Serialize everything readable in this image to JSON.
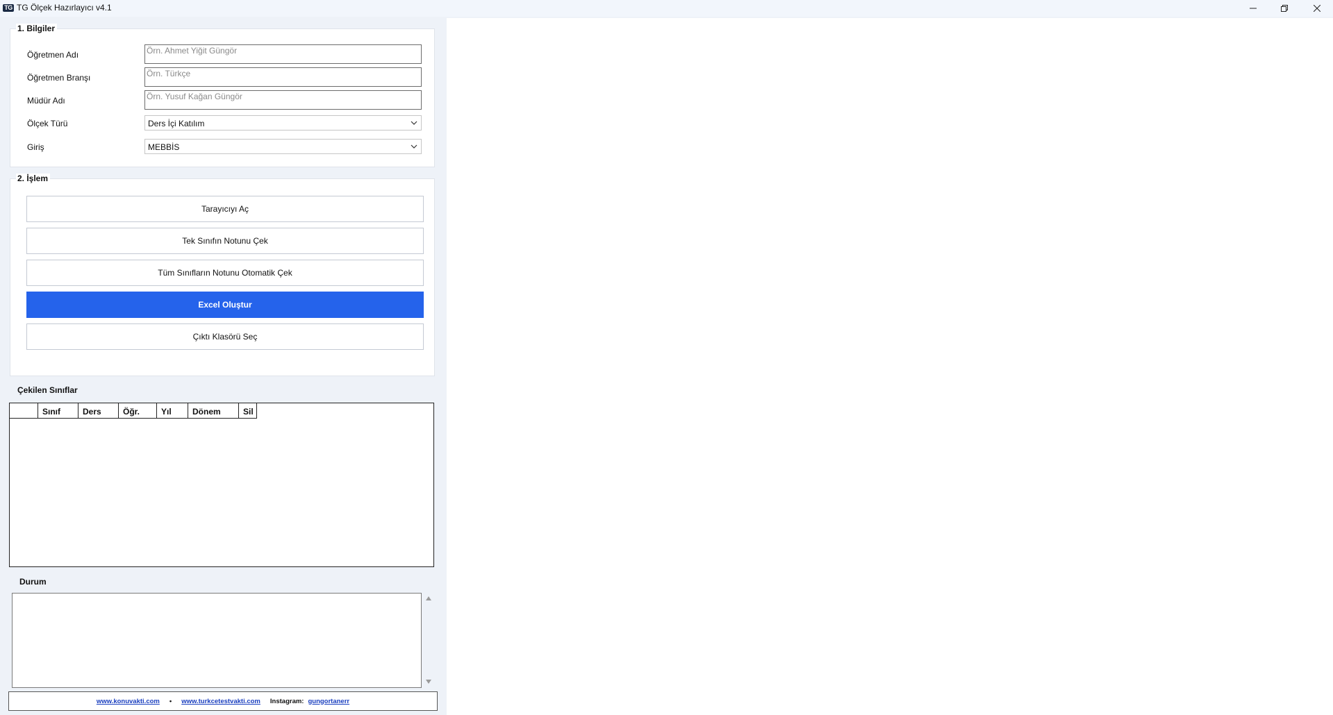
{
  "window": {
    "logo_text": "TG",
    "title": "TG Ölçek Hazırlayıcı v4.1",
    "controls": [
      "minimize-icon",
      "restore-icon",
      "close-icon"
    ]
  },
  "bilgiler": {
    "title": "1. Bilgiler",
    "teacher_name": {
      "label": "Öğretmen Adı",
      "value": "",
      "placeholder": "Örn. Ahmet Yiğit Güngör"
    },
    "teacher_branch": {
      "label": "Öğretmen Branşı",
      "value": "",
      "placeholder": "Örn. Türkçe"
    },
    "principal_name": {
      "label": "Müdür Adı",
      "value": "",
      "placeholder": "Örn. Yusuf Kağan Güngör"
    },
    "scale_type": {
      "label": "Ölçek Türü",
      "selected": "Ders İçi Katılım"
    },
    "login": {
      "label": "Giriş",
      "selected": "MEBBİS"
    }
  },
  "islem": {
    "title": "2. İşlem",
    "buttons": {
      "open_browser": "Tarayıcıyı Aç",
      "fetch_single": "Tek Sınıfın Notunu Çek",
      "fetch_all": "Tüm Sınıfların Notunu Otomatik Çek",
      "create_excel": "Excel Oluştur",
      "select_output": "Çıktı Klasörü Seç"
    },
    "accent_color": "#2563eb"
  },
  "classes": {
    "title": "Çekilen Sınıflar",
    "columns": [
      "",
      "Sınıf",
      "Ders",
      "Öğr.",
      "Yıl",
      "Dönem",
      "Sil"
    ],
    "rows": []
  },
  "status": {
    "title": "Durum",
    "text": ""
  },
  "footer": {
    "link1": "www.konuvakti.com",
    "separator": "•",
    "link2": "www.turkcetestvakti.com",
    "instagram_label": "Instagram:",
    "instagram_handle": "gungortanerr"
  }
}
